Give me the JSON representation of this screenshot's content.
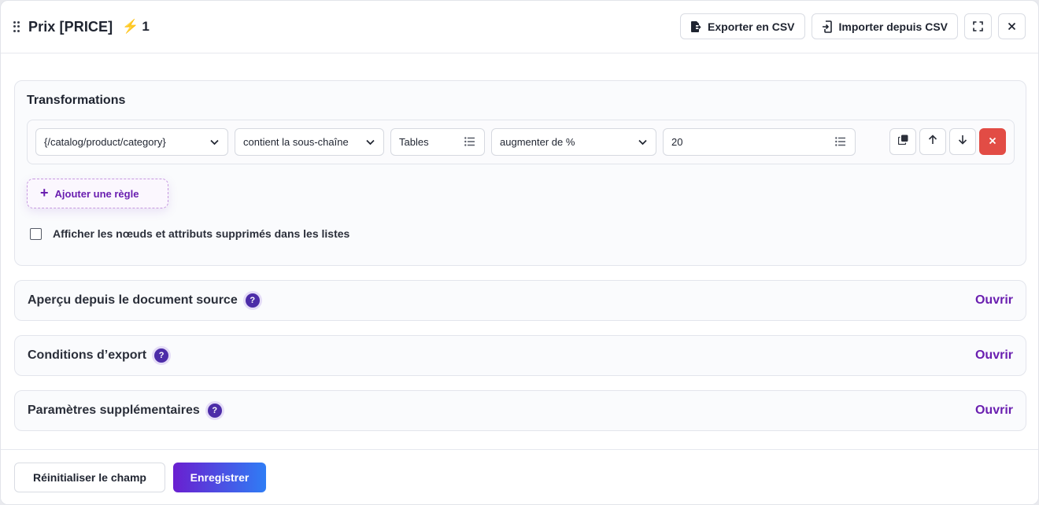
{
  "header": {
    "title": "Prix [PRICE]",
    "badge_count": "1",
    "export_csv_label": "Exporter en CSV",
    "import_csv_label": "Importer depuis CSV"
  },
  "transformations": {
    "title": "Transformations",
    "rule": {
      "source_field": "{/catalog/product/category}",
      "condition": "contient la sous-chaîne",
      "condition_value": "Tables",
      "action": "augmenter de %",
      "action_value": "20"
    },
    "add_rule_label": "Ajouter une règle",
    "show_deleted_label": "Afficher les nœuds et attributs supprimés dans les listes",
    "show_deleted_checked": false
  },
  "sections": [
    {
      "title": "Aperçu depuis le document source",
      "help": "?",
      "open_label": "Ouvrir"
    },
    {
      "title": "Conditions d’export",
      "help": "?",
      "open_label": "Ouvrir"
    },
    {
      "title": "Paramètres supplémentaires",
      "help": "?",
      "open_label": "Ouvrir"
    }
  ],
  "footer": {
    "reset_label": "Réinitialiser le champ",
    "save_label": "Enregistrer"
  },
  "colors": {
    "accent": "#6a1fb0",
    "danger": "#e24c45",
    "bolt": "#f3b51b"
  }
}
